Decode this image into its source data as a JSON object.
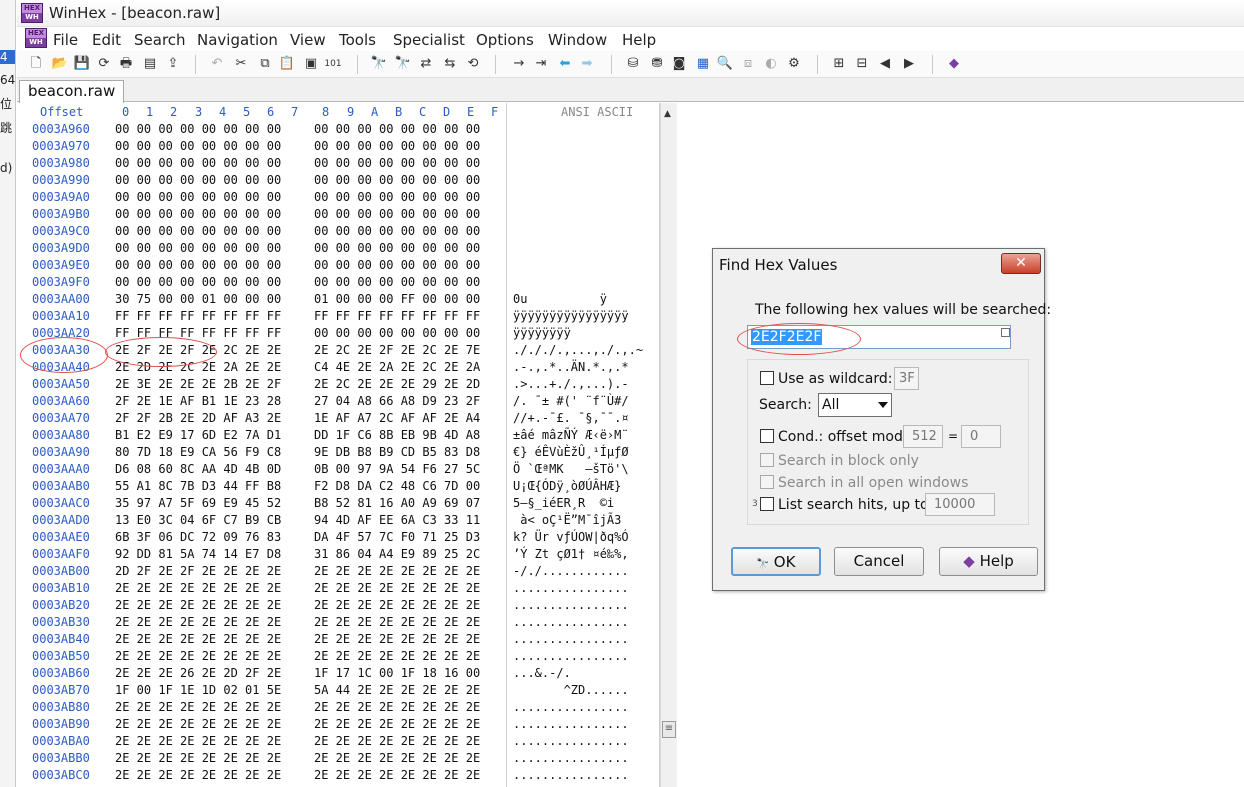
{
  "left_strip": [
    "4",
    "64",
    "位",
    "跳",
    "d)"
  ],
  "window": {
    "title": "WinHex - [beacon.raw]"
  },
  "menu": [
    "File",
    "Edit",
    "Search",
    "Navigation",
    "View",
    "Tools",
    "Specialist",
    "Options",
    "Window",
    "Help"
  ],
  "tabs": [
    {
      "label": "beacon.raw"
    }
  ],
  "hex_header": {
    "offset_label": "Offset",
    "columns": [
      "0",
      "1",
      "2",
      "3",
      "4",
      "5",
      "6",
      "7",
      "8",
      "9",
      "A",
      "B",
      "C",
      "D",
      "E",
      "F"
    ],
    "ascii_label": "ANSI ASCII"
  },
  "rows": [
    {
      "offset": "0003A960",
      "bytes1": "00 00 00 00 00 00 00 00",
      "bytes2": "00 00 00 00 00 00 00 00",
      "ascii": ""
    },
    {
      "offset": "0003A970",
      "bytes1": "00 00 00 00 00 00 00 00",
      "bytes2": "00 00 00 00 00 00 00 00",
      "ascii": ""
    },
    {
      "offset": "0003A980",
      "bytes1": "00 00 00 00 00 00 00 00",
      "bytes2": "00 00 00 00 00 00 00 00",
      "ascii": ""
    },
    {
      "offset": "0003A990",
      "bytes1": "00 00 00 00 00 00 00 00",
      "bytes2": "00 00 00 00 00 00 00 00",
      "ascii": ""
    },
    {
      "offset": "0003A9A0",
      "bytes1": "00 00 00 00 00 00 00 00",
      "bytes2": "00 00 00 00 00 00 00 00",
      "ascii": ""
    },
    {
      "offset": "0003A9B0",
      "bytes1": "00 00 00 00 00 00 00 00",
      "bytes2": "00 00 00 00 00 00 00 00",
      "ascii": ""
    },
    {
      "offset": "0003A9C0",
      "bytes1": "00 00 00 00 00 00 00 00",
      "bytes2": "00 00 00 00 00 00 00 00",
      "ascii": ""
    },
    {
      "offset": "0003A9D0",
      "bytes1": "00 00 00 00 00 00 00 00",
      "bytes2": "00 00 00 00 00 00 00 00",
      "ascii": ""
    },
    {
      "offset": "0003A9E0",
      "bytes1": "00 00 00 00 00 00 00 00",
      "bytes2": "00 00 00 00 00 00 00 00",
      "ascii": ""
    },
    {
      "offset": "0003A9F0",
      "bytes1": "00 00 00 00 00 00 00 00",
      "bytes2": "00 00 00 00 00 00 00 00",
      "ascii": ""
    },
    {
      "offset": "0003AA00",
      "bytes1": "30 75 00 00 01 00 00 00",
      "bytes2": "01 00 00 00 FF 00 00 00",
      "ascii": "0u          ÿ"
    },
    {
      "offset": "0003AA10",
      "bytes1": "FF FF FF FF FF FF FF FF",
      "bytes2": "FF FF FF FF FF FF FF FF",
      "ascii": "ÿÿÿÿÿÿÿÿÿÿÿÿÿÿÿÿ"
    },
    {
      "offset": "0003AA20",
      "bytes1": "FF FF FF FF FF FF FF FF",
      "bytes2": "00 00 00 00 00 00 00 00",
      "ascii": "ÿÿÿÿÿÿÿÿ"
    },
    {
      "offset": "0003AA30",
      "bytes1": "2E 2F 2E 2F 2E 2C 2E 2E",
      "bytes2": "2E 2C 2E 2F 2E 2C 2E 7E",
      "ascii": "./././.,...,./.,.~"
    },
    {
      "offset": "0003AA40",
      "bytes1": "2E 2D 2E 2C 2E 2A 2E 2E",
      "bytes2": "C4 4E 2E 2A 2E 2C 2E 2A",
      "ascii": ".-.,.*..ÄN.*.,.*"
    },
    {
      "offset": "0003AA50",
      "bytes1": "2E 3E 2E 2E 2E 2B 2E 2F",
      "bytes2": "2E 2C 2E 2E 2E 29 2E 2D",
      "ascii": ".>...+./.,...).-"
    },
    {
      "offset": "0003AA60",
      "bytes1": "2F 2E 1E AF B1 1E 23 28",
      "bytes2": "27 04 A8 66 A8 D9 23 2F",
      "ascii": "/. ¯± #(' ¨f¨Ù#/"
    },
    {
      "offset": "0003AA70",
      "bytes1": "2F 2F 2B 2E 2D AF A3 2E",
      "bytes2": "1E AF A7 2C AF AF 2E A4",
      "ascii": "//+.-¯£. ¯§,¯¯.¤"
    },
    {
      "offset": "0003AA80",
      "bytes1": "B1 E2 E9 17 6D E2 7A D1",
      "bytes2": "DD 1F C6 8B EB 9B 4D A8",
      "ascii": "±âé mâzÑÝ Æ‹ë›M¨"
    },
    {
      "offset": "0003AA90",
      "bytes1": "80 7D 18 E9 CA 56 F9 C8",
      "bytes2": "9E DB B8 B9 CD B5 83 D8",
      "ascii": "€} éÊVùÈžÛ¸¹ÍµƒØ"
    },
    {
      "offset": "0003AAA0",
      "bytes1": "D6 08 60 8C AA 4D 4B 0D",
      "bytes2": "0B 00 97 9A 54 F6 27 5C",
      "ascii": "Ö `ŒªMK   —šTö'\\"
    },
    {
      "offset": "0003AAB0",
      "bytes1": "55 A1 8C 7B D3 44 FF B8",
      "bytes2": "F2 D8 DA C2 48 C6 7D 00",
      "ascii": "U¡Œ{ÓDÿ¸òØÚÂHÆ}"
    },
    {
      "offset": "0003AAC0",
      "bytes1": "35 97 A7 5F 69 E9 45 52",
      "bytes2": "B8 52 81 16 A0 A9 69 07",
      "ascii": "5—§_iéER¸R  ©i"
    },
    {
      "offset": "0003AAD0",
      "bytes1": "13 E0 3C 04 6F C7 B9 CB",
      "bytes2": "94 4D AF EE 6A C3 33 11",
      "ascii": " à< oÇ¹Ë”M¯îjÃ3"
    },
    {
      "offset": "0003AAE0",
      "bytes1": "6B 3F 06 DC 72 09 76 83",
      "bytes2": "DA 4F 57 7C F0 71 25 D3",
      "ascii": "k? Ür vƒÚOW|ðq%Ó"
    },
    {
      "offset": "0003AAF0",
      "bytes1": "92 DD 81 5A 74 14 E7 D8",
      "bytes2": "31 86 04 A4 E9 89 25 2C",
      "ascii": "’Ý Zt çØ1† ¤é‰%,"
    },
    {
      "offset": "0003AB00",
      "bytes1": "2D 2F 2E 2F 2E 2E 2E 2E",
      "bytes2": "2E 2E 2E 2E 2E 2E 2E 2E",
      "ascii": "-/./............"
    },
    {
      "offset": "0003AB10",
      "bytes1": "2E 2E 2E 2E 2E 2E 2E 2E",
      "bytes2": "2E 2E 2E 2E 2E 2E 2E 2E",
      "ascii": "................"
    },
    {
      "offset": "0003AB20",
      "bytes1": "2E 2E 2E 2E 2E 2E 2E 2E",
      "bytes2": "2E 2E 2E 2E 2E 2E 2E 2E",
      "ascii": "................"
    },
    {
      "offset": "0003AB30",
      "bytes1": "2E 2E 2E 2E 2E 2E 2E 2E",
      "bytes2": "2E 2E 2E 2E 2E 2E 2E 2E",
      "ascii": "................"
    },
    {
      "offset": "0003AB40",
      "bytes1": "2E 2E 2E 2E 2E 2E 2E 2E",
      "bytes2": "2E 2E 2E 2E 2E 2E 2E 2E",
      "ascii": "................"
    },
    {
      "offset": "0003AB50",
      "bytes1": "2E 2E 2E 2E 2E 2E 2E 2E",
      "bytes2": "2E 2E 2E 2E 2E 2E 2E 2E",
      "ascii": "................"
    },
    {
      "offset": "0003AB60",
      "bytes1": "2E 2E 2E 26 2E 2D 2F 2E",
      "bytes2": "1F 17 1C 00 1F 18 16 00",
      "ascii": "...&.-/."
    },
    {
      "offset": "0003AB70",
      "bytes1": "1F 00 1F 1E 1D 02 01 5E",
      "bytes2": "5A 44 2E 2E 2E 2E 2E 2E",
      "ascii": "       ^ZD......"
    },
    {
      "offset": "0003AB80",
      "bytes1": "2E 2E 2E 2E 2E 2E 2E 2E",
      "bytes2": "2E 2E 2E 2E 2E 2E 2E 2E",
      "ascii": "................"
    },
    {
      "offset": "0003AB90",
      "bytes1": "2E 2E 2E 2E 2E 2E 2E 2E",
      "bytes2": "2E 2E 2E 2E 2E 2E 2E 2E",
      "ascii": "................"
    },
    {
      "offset": "0003ABA0",
      "bytes1": "2E 2E 2E 2E 2E 2E 2E 2E",
      "bytes2": "2E 2E 2E 2E 2E 2E 2E 2E",
      "ascii": "................"
    },
    {
      "offset": "0003ABB0",
      "bytes1": "2E 2E 2E 2E 2E 2E 2E 2E",
      "bytes2": "2E 2E 2E 2E 2E 2E 2E 2E",
      "ascii": "................"
    },
    {
      "offset": "0003ABC0",
      "bytes1": "2E 2E 2E 2E 2E 2E 2E 2E",
      "bytes2": "2E 2E 2E 2E 2E 2E 2E 2E",
      "ascii": "................"
    }
  ],
  "dialog": {
    "title": "Find Hex Values",
    "close_glyph": "✕",
    "prompt": "The following hex values will be searched:",
    "hex_value": "2E2F2E2F",
    "wildcard_label": "Use as wildcard:",
    "wildcard_value": "3F",
    "search_label": "Search:",
    "search_value": "All",
    "cond_label": "Cond.: offset mod",
    "cond_mod": "512",
    "cond_eq": "=",
    "cond_value": "0",
    "block_only": "Search in block only",
    "all_windows": "Search in all open windows",
    "list_hits_prefix": "3",
    "list_hits": "List search hits, up to",
    "hits_value": "10000",
    "ok": "OK",
    "cancel": "Cancel",
    "help": "Help"
  },
  "colors": {
    "accent": "#2b5cc4",
    "annotation": "#e05050",
    "selection": "#3399ff"
  }
}
